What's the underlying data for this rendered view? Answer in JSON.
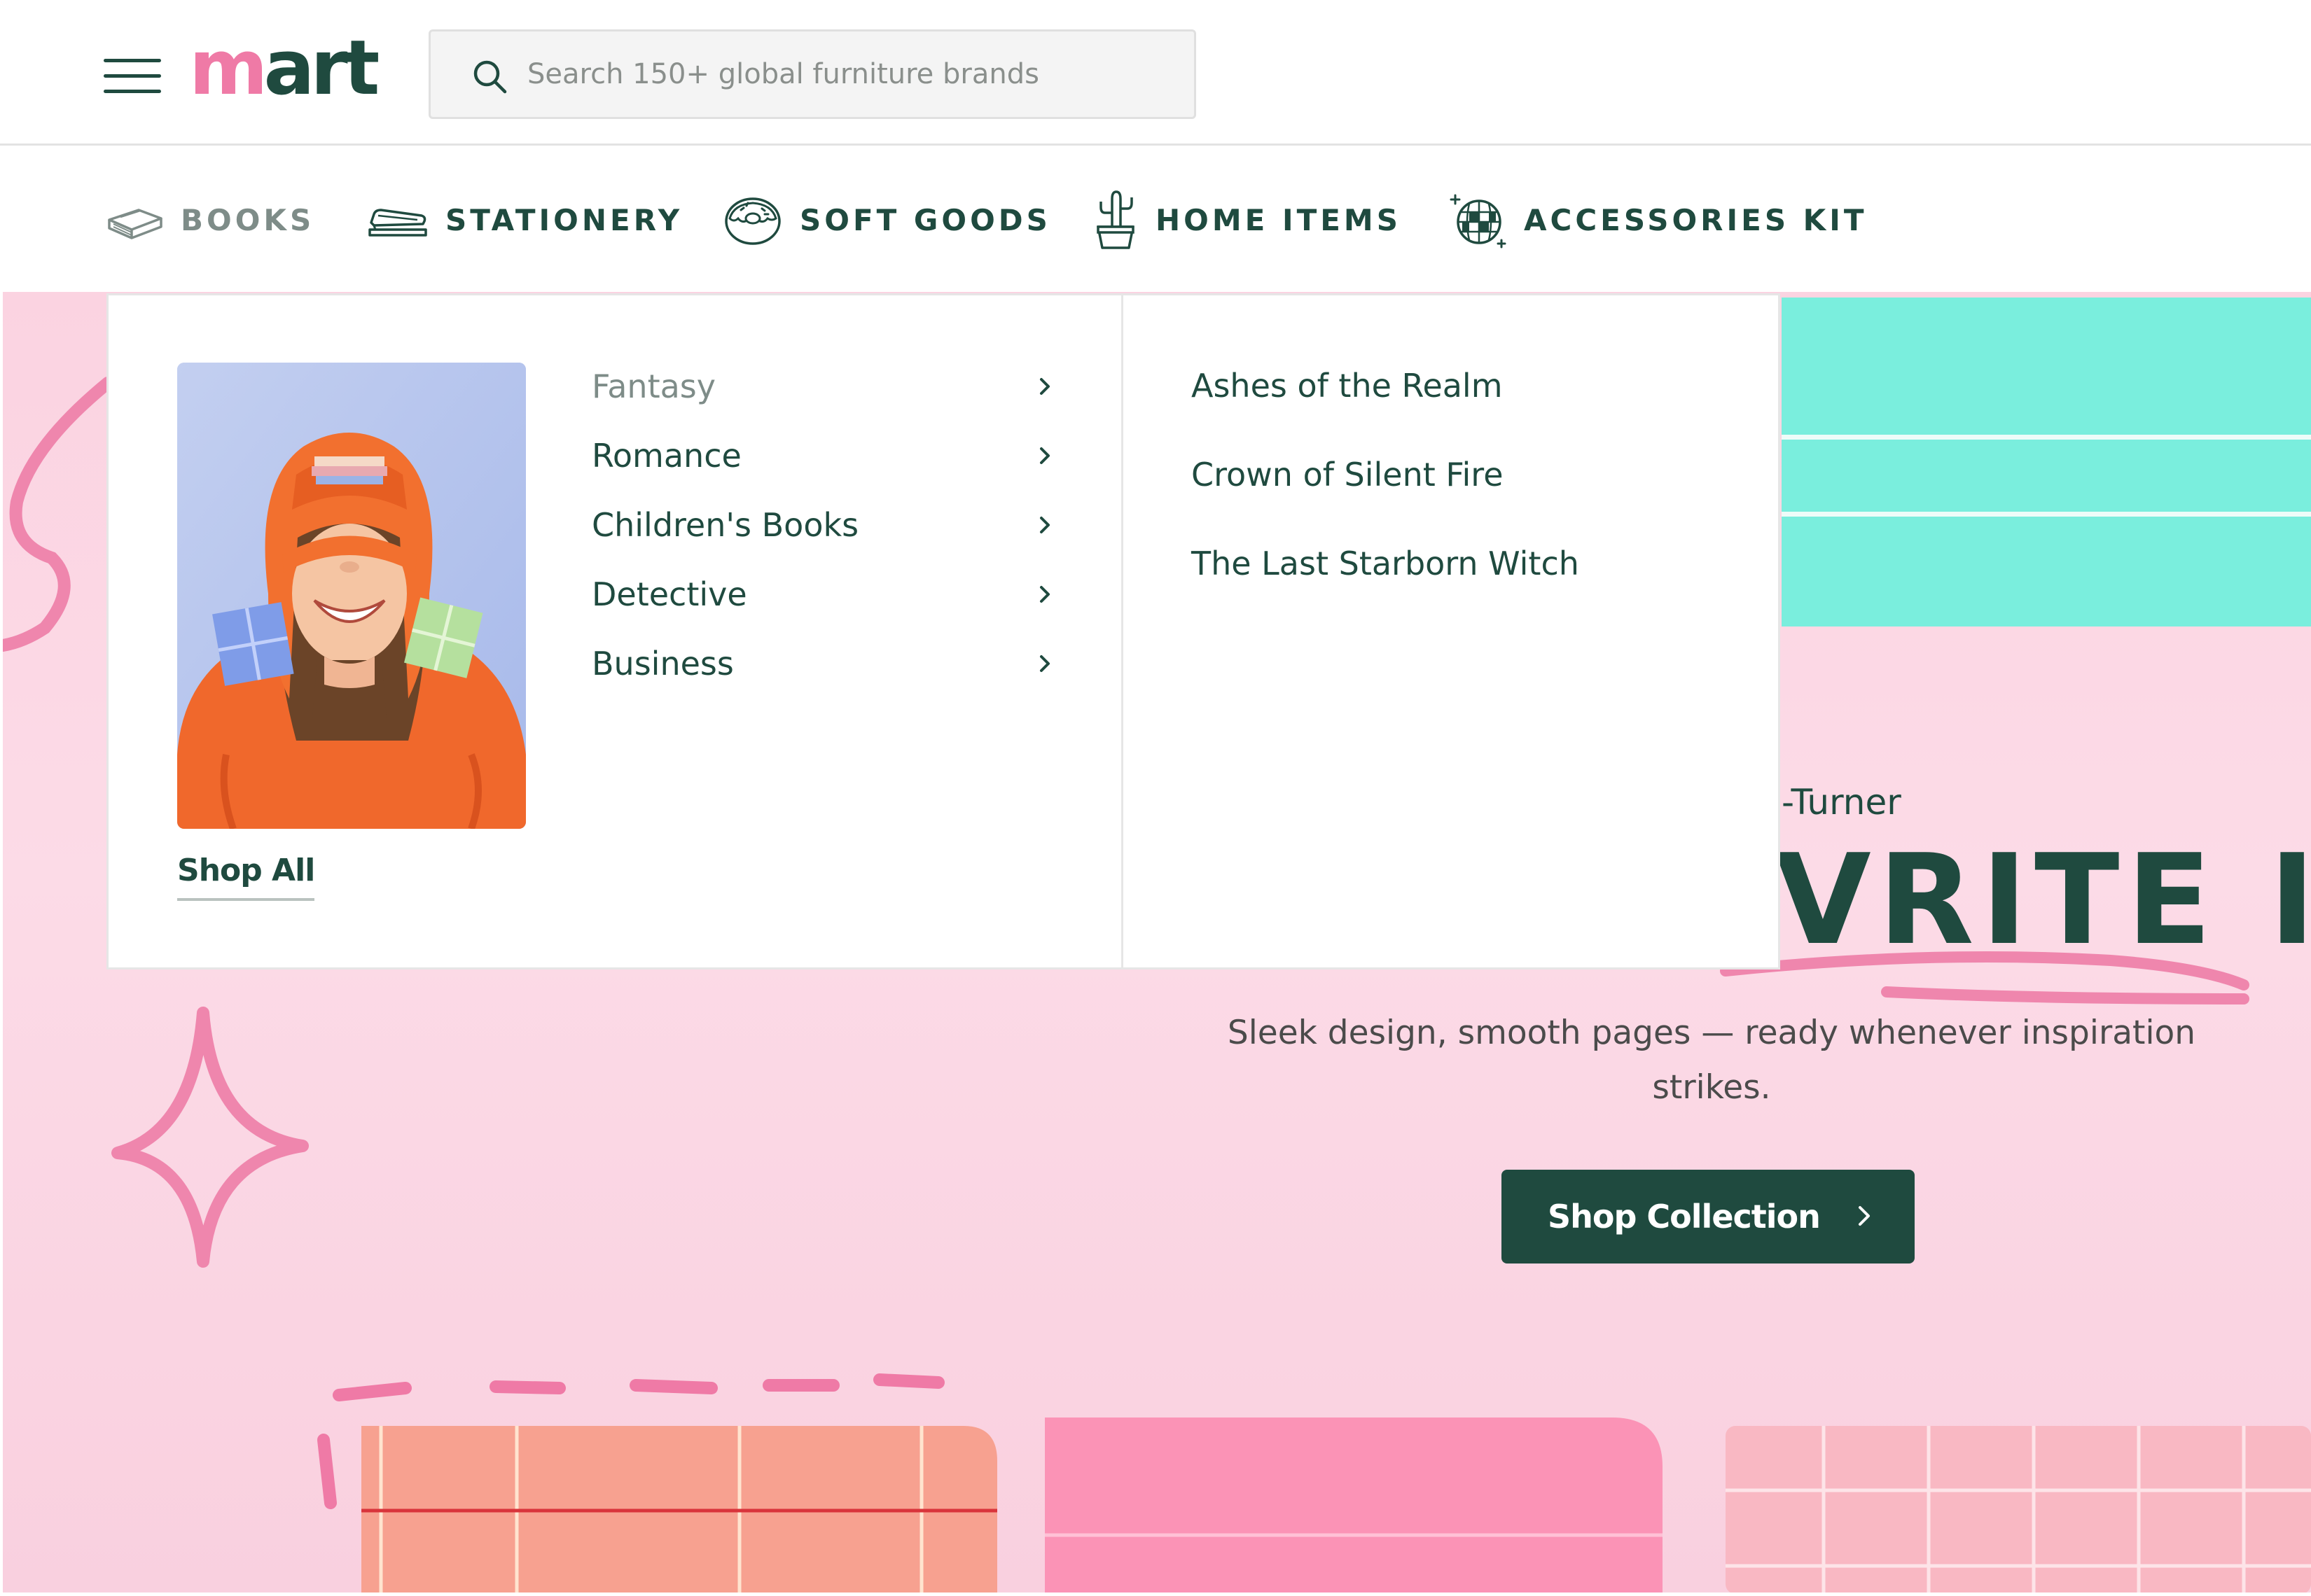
{
  "header": {
    "logo_first": "m",
    "logo_rest": "art",
    "search": {
      "placeholder": "Search 150+ global furniture brands",
      "value": ""
    }
  },
  "categories": [
    {
      "label": "BOOKS",
      "icon": "book-icon",
      "active": true
    },
    {
      "label": "STATIONERY",
      "icon": "stapler-icon",
      "active": false
    },
    {
      "label": "SOFT GOODS",
      "icon": "donut-icon",
      "active": false
    },
    {
      "label": "HOME ITEMS",
      "icon": "potted-cactus-icon",
      "active": false
    },
    {
      "label": "ACCESSORIES KIT",
      "icon": "disco-ball-icon",
      "active": false
    }
  ],
  "mega_menu": {
    "shop_all": "Shop All",
    "subcategories": [
      {
        "label": "Fantasy",
        "active": true
      },
      {
        "label": "Romance",
        "active": false
      },
      {
        "label": "Children's Books",
        "active": false
      },
      {
        "label": "Detective",
        "active": false
      },
      {
        "label": "Business",
        "active": false
      }
    ],
    "books": [
      "Ashes of the Realm",
      "Crown of Silent Fire",
      "The Last Starborn Witch"
    ]
  },
  "hero": {
    "author_fragment": "-Turner",
    "title_fragment": "VRITE IT.",
    "subtitle": "Sleek design, smooth pages — ready whenever inspiration strikes.",
    "cta_label": "Shop Collection"
  },
  "colors": {
    "brand_green": "#1f4a3f",
    "brand_pink": "#ef7aa6",
    "hero_bg": "#fbd3e1",
    "teal": "#7aeedd"
  }
}
